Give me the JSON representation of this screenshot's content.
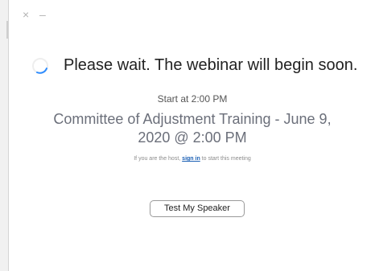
{
  "window": {
    "close_glyph": "×",
    "minimize_glyph": "–"
  },
  "status": {
    "icon": "spinner-icon",
    "message": "Please wait. The webinar will begin soon."
  },
  "schedule": {
    "start_text": "Start at 2:00 PM"
  },
  "meeting": {
    "title": "Committee of Adjustment Training - June 9, 2020 @ 2:00 PM"
  },
  "host_note": {
    "prefix": "If you are the host, ",
    "link_text": "sign in",
    "suffix": " to start this meeting"
  },
  "actions": {
    "test_speaker_label": "Test My Speaker"
  },
  "colors": {
    "link": "#1a5fb4",
    "title_text": "#6b6f7a",
    "spinner": "#2d8cff"
  }
}
